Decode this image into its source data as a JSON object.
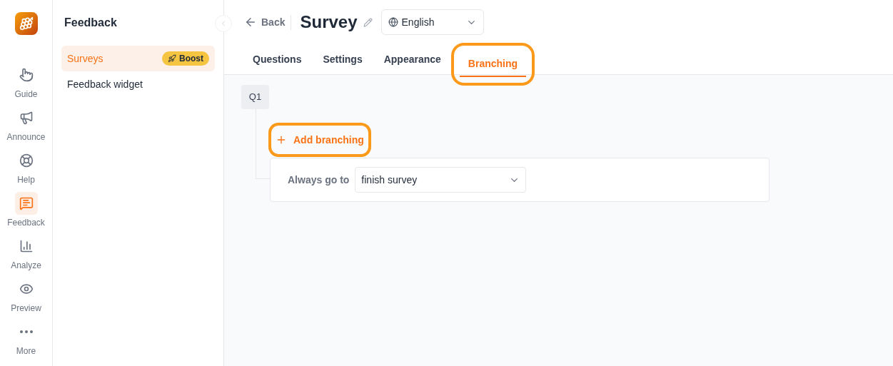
{
  "rail": {
    "items": [
      {
        "kind": "guide",
        "label": "Guide",
        "selected": false
      },
      {
        "kind": "announce",
        "label": "Announce",
        "selected": false
      },
      {
        "kind": "help",
        "label": "Help",
        "selected": false
      },
      {
        "kind": "feedback",
        "label": "Feedback",
        "selected": true
      },
      {
        "kind": "analyze",
        "label": "Analyze",
        "selected": false
      },
      {
        "kind": "preview",
        "label": "Preview",
        "selected": false
      },
      {
        "kind": "more",
        "label": "More",
        "selected": false
      }
    ]
  },
  "sidebar": {
    "title": "Feedback",
    "items": [
      {
        "label": "Surveys",
        "selected": true,
        "badge": "Boost"
      },
      {
        "label": "Feedback widget",
        "selected": false
      }
    ]
  },
  "header": {
    "back": "Back",
    "title": "Survey",
    "language": "English"
  },
  "tabs": [
    {
      "label": "Questions",
      "selected": false,
      "highlighted": false
    },
    {
      "label": "Settings",
      "selected": false,
      "highlighted": false
    },
    {
      "label": "Appearance",
      "selected": false,
      "highlighted": false
    },
    {
      "label": "Branching",
      "selected": true,
      "highlighted": true
    }
  ],
  "branching": {
    "question": "Q1",
    "add_button": {
      "label": "Add branching",
      "highlighted": true
    },
    "rule_label": "Always go to",
    "rule_value": "finish survey"
  }
}
